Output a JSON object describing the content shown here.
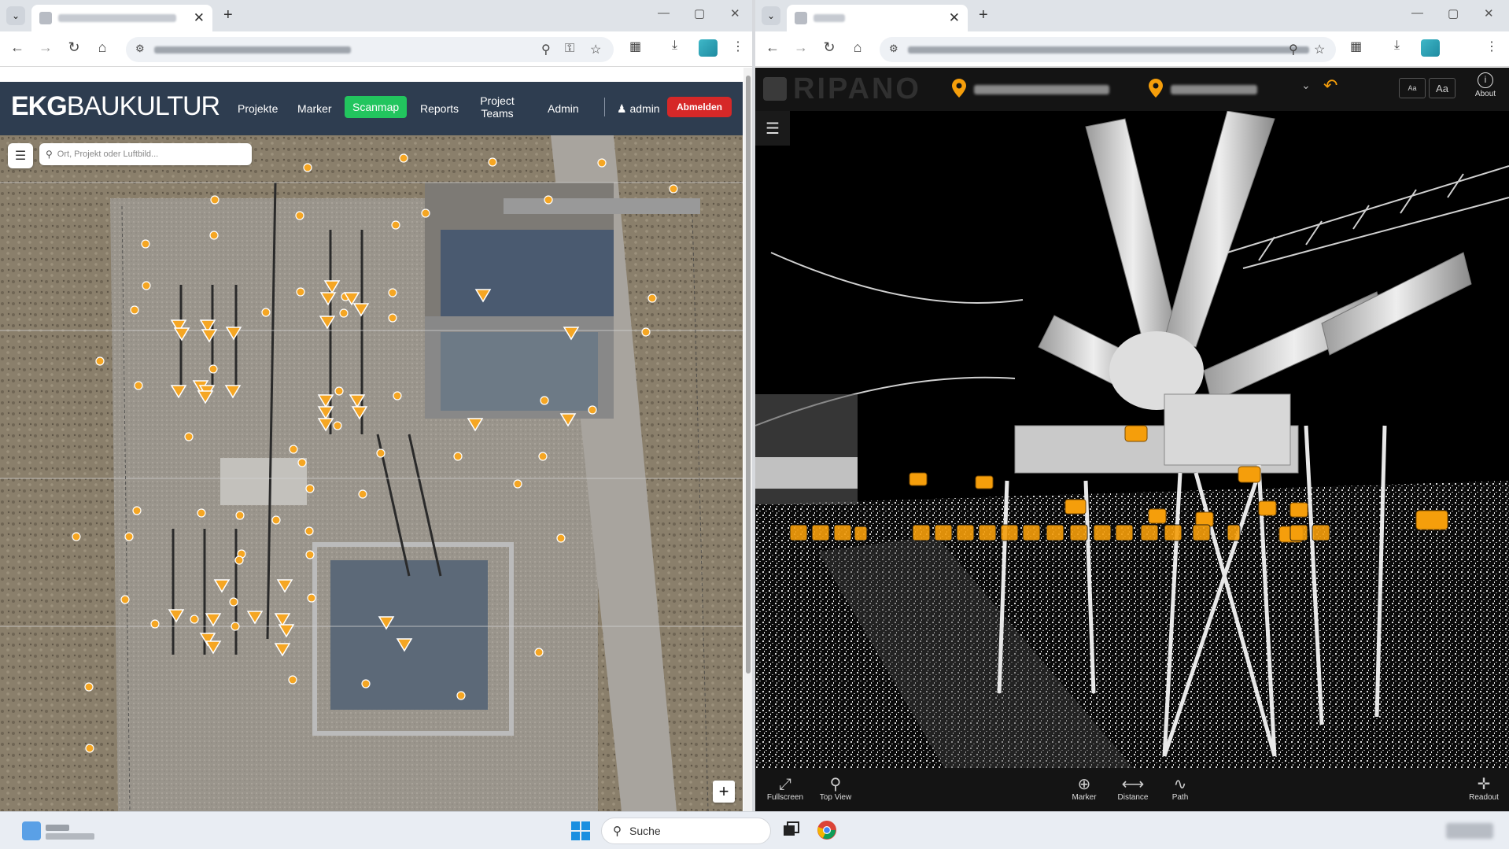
{
  "left_window": {
    "tab_title": "",
    "address": "",
    "app": {
      "logo_bold": "EKG",
      "logo_rest": "BAUKULTUR",
      "nav": [
        "Projekte",
        "Marker",
        "Scanmap",
        "Reports",
        "Project\nTeams",
        "Admin"
      ],
      "active_nav": "Scanmap",
      "user": "admin",
      "logout": "Abmelden",
      "search_placeholder": "Ort, Projekt oder Luftbild...",
      "zoom_in": "+"
    }
  },
  "right_window": {
    "tab_title": "",
    "address": "",
    "app": {
      "logo": "RIPANO",
      "font_small": "Aa",
      "font_large": "Aa",
      "about": "About",
      "bottom": {
        "fullscreen": "Fullscreen",
        "top_view": "Top View",
        "marker": "Marker",
        "distance": "Distance",
        "path": "Path",
        "readout": "Readout"
      }
    }
  },
  "taskbar": {
    "search": "Suche"
  },
  "colors": {
    "ekg_header": "#2e3d50",
    "scanmap_active": "#22c55e",
    "logout": "#d62828",
    "marker_orange": "#f5a623",
    "ripano_bg": "#141414"
  }
}
